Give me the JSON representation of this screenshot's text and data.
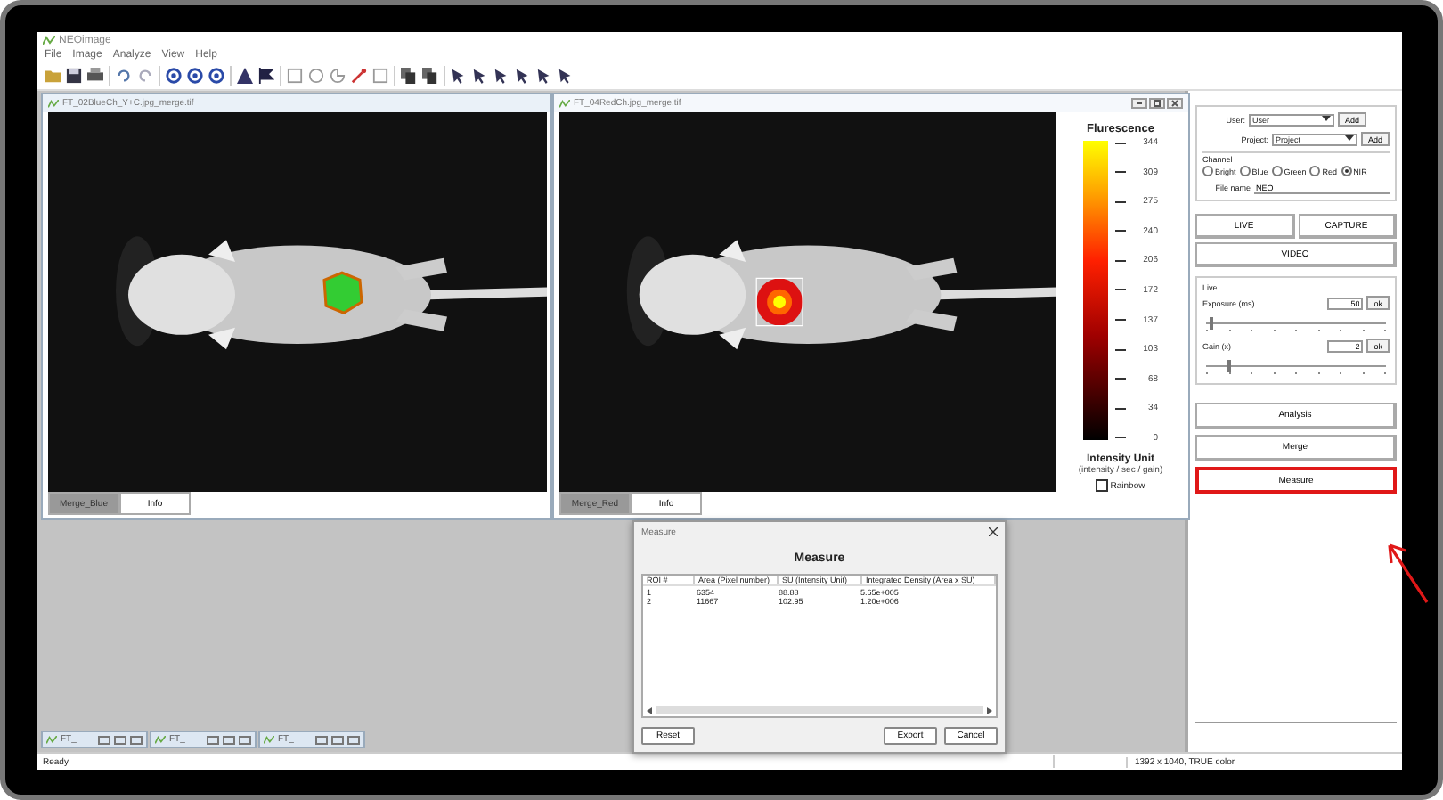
{
  "app": {
    "title": "NEOimage",
    "menu": [
      "File",
      "Image",
      "Analyze",
      "View",
      "Help"
    ]
  },
  "image_windows": [
    {
      "title": "FT_02BlueCh_Y+C.jpg_merge.tif",
      "active": false,
      "kind": "greenspot",
      "tabs": [
        {
          "label": "Merge_Blue",
          "selected": true
        },
        {
          "label": "Info",
          "selected": false
        }
      ]
    },
    {
      "title": "FT_04RedCh.jpg_merge.tif",
      "active": true,
      "kind": "heatmap",
      "tabs": [
        {
          "label": "Merge_Red",
          "selected": true
        },
        {
          "label": "Info",
          "selected": false
        }
      ],
      "colorbar": {
        "title": "Flurescence",
        "ticks": [
          "344",
          "309",
          "275",
          "240",
          "206",
          "172",
          "137",
          "103",
          "68",
          "34",
          "0"
        ],
        "unit_title": "Intensity Unit",
        "unit_desc": "(intensity / sec / gain)",
        "rainbow": {
          "label": "Rainbow",
          "checked": false
        }
      }
    }
  ],
  "minimized_windows": [
    "FT_",
    "FT_",
    "FT_"
  ],
  "measure_dialog": {
    "window_title": "Measure",
    "heading": "Measure",
    "columns": [
      "ROI #",
      "Area (Pixel number)",
      "SU (Intensity Unit)",
      "Integrated Density (Area x SU)"
    ],
    "rows": [
      [
        "1",
        "6354",
        "88.88",
        "5.65e+005"
      ],
      [
        "2",
        "11667",
        "102.95",
        "1.20e+006"
      ]
    ],
    "buttons": [
      "Reset",
      "Export",
      "Cancel"
    ]
  },
  "control_panel": {
    "user": {
      "label": "User:",
      "value": "User",
      "button": "Add"
    },
    "project": {
      "label": "Project:",
      "value": "Project",
      "button": "Add"
    },
    "channel": {
      "title": "Channel",
      "options": [
        {
          "label": "Bright",
          "selected": false
        },
        {
          "label": "Blue",
          "selected": false
        },
        {
          "label": "Green",
          "selected": false
        },
        {
          "label": "Red",
          "selected": false
        },
        {
          "label": "NIR",
          "selected": true
        }
      ]
    },
    "file_name": {
      "label": "File name",
      "value": "NEO"
    },
    "capture_buttons": [
      "LIVE",
      "CAPTURE",
      "VIDEO"
    ],
    "live": {
      "title": "Live",
      "exposure": {
        "label": "Exposure (ms)",
        "value": "50",
        "button": "ok",
        "level": 0.03
      },
      "gain": {
        "label": "Gain (x)",
        "value": "2",
        "button": "ok",
        "level": 0.13
      }
    },
    "actions": [
      {
        "label": "Analysis",
        "highlighted": false
      },
      {
        "label": "Merge",
        "highlighted": false
      },
      {
        "label": "Measure",
        "highlighted": true
      }
    ]
  },
  "status_bar": {
    "text": "Ready",
    "info": "1392 x 1040, TRUE color"
  }
}
